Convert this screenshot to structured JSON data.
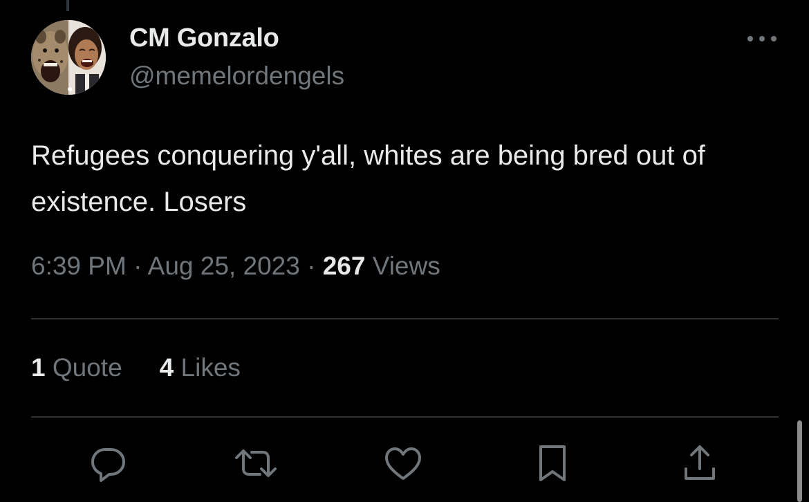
{
  "tweet": {
    "author": {
      "display_name": "CM Gonzalo",
      "handle": "@memelordengels"
    },
    "text": "Refugees conquering y'all, whites are being bred out of existence. Losers",
    "time": "6:39 PM",
    "separator": "·",
    "date": "Aug 25, 2023",
    "views_count": "267",
    "views_label": "Views"
  },
  "engagement": {
    "quotes_count": "1",
    "quotes_label": "Quote",
    "likes_count": "4",
    "likes_label": "Likes"
  },
  "actions": {
    "icons": [
      "reply-icon",
      "retweet-icon",
      "like-icon",
      "bookmark-icon",
      "share-icon"
    ]
  },
  "colors": {
    "background": "#000000",
    "primary_text": "#e7e9ea",
    "secondary_text": "#71767b",
    "divider": "#2f3336"
  }
}
